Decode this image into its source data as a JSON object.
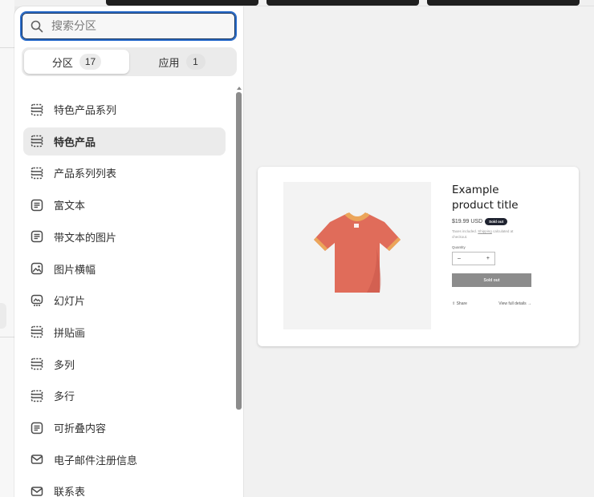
{
  "search": {
    "placeholder": "搜索分区"
  },
  "tabs": [
    {
      "label": "分区",
      "count": "17",
      "active": true
    },
    {
      "label": "应用",
      "count": "1",
      "active": false
    }
  ],
  "sections": [
    {
      "label": "特色产品系列",
      "icon": "grid-section-icon"
    },
    {
      "label": "特色产品",
      "icon": "grid-section-icon",
      "active": true
    },
    {
      "label": "产品系列列表",
      "icon": "grid-section-icon"
    },
    {
      "label": "富文本",
      "icon": "text-block-icon"
    },
    {
      "label": "带文本的图片",
      "icon": "text-block-icon"
    },
    {
      "label": "图片横幅",
      "icon": "image-icon"
    },
    {
      "label": "幻灯片",
      "icon": "slideshow-icon"
    },
    {
      "label": "拼贴画",
      "icon": "grid-section-icon"
    },
    {
      "label": "多列",
      "icon": "grid-section-icon"
    },
    {
      "label": "多行",
      "icon": "grid-section-icon"
    },
    {
      "label": "可折叠内容",
      "icon": "text-block-icon"
    },
    {
      "label": "电子邮件注册信息",
      "icon": "email-icon"
    },
    {
      "label": "联系表",
      "icon": "email-icon"
    }
  ],
  "preview": {
    "title": "Example product title",
    "price": "$19.99 USD",
    "badge": "Sold out",
    "tax_prefix": "Taxes included.",
    "tax_link": "Shipping",
    "tax_suffix": "calculated at checkout.",
    "quantity_label": "Quantity",
    "qty_minus": "–",
    "qty_plus": "+",
    "soldout_button": "Sold out",
    "share": "Share",
    "view_details": "View full details →"
  },
  "colors": {
    "focus_ring": "#2c6ecb",
    "shirt": "#e06c5a",
    "shirt_trim": "#eba55a"
  }
}
